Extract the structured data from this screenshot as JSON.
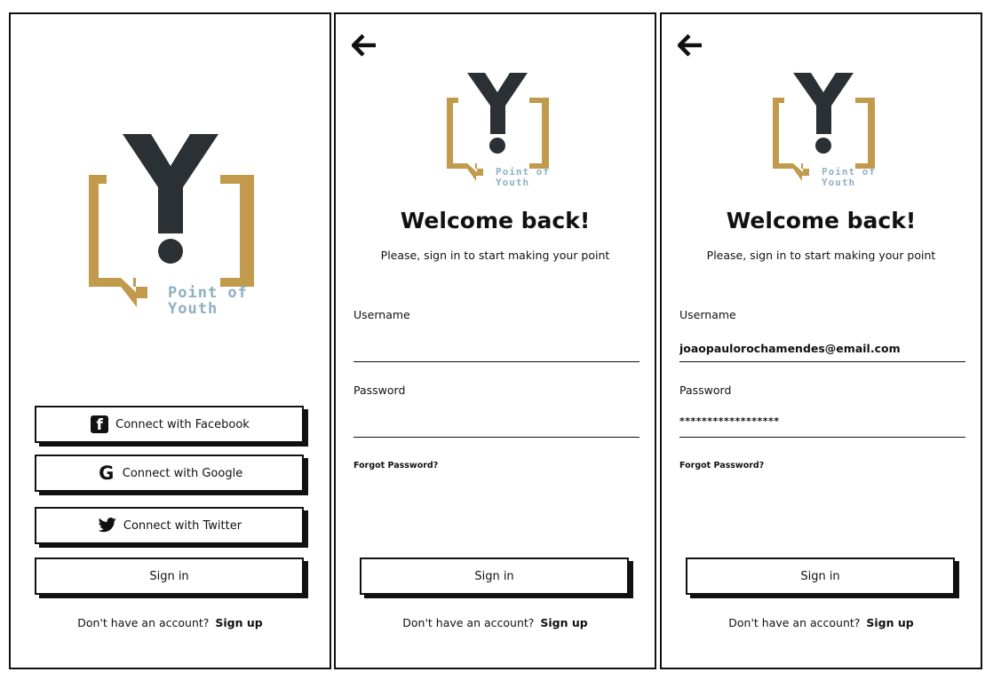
{
  "colors": {
    "gold": "#c29a4c",
    "dark": "#2a3033",
    "logo_text": "#8fb0c3",
    "border": "#111111"
  },
  "logo": {
    "line1": "Point of",
    "line2": "Youth"
  },
  "screen1": {
    "buttons": {
      "facebook": {
        "label": "Connect with Facebook",
        "icon": "facebook-icon"
      },
      "google": {
        "label": "Connect with Google",
        "icon": "google-icon"
      },
      "twitter": {
        "label": "Connect with Twitter",
        "icon": "twitter-icon"
      },
      "signin": "Sign in"
    },
    "footer": {
      "text": "Don't have an account?",
      "link": "Sign up"
    }
  },
  "screen2": {
    "title": "Welcome back!",
    "subtitle": "Please, sign in to start making your point",
    "username_label": "Username",
    "username_value": "",
    "password_label": "Password",
    "password_value": "",
    "forgot": "Forgot Password?",
    "signin": "Sign in",
    "footer": {
      "text": "Don't have an account?",
      "link": "Sign up"
    }
  },
  "screen3": {
    "title": "Welcome back!",
    "subtitle": "Please, sign in to start making your point",
    "username_label": "Username",
    "username_value": "joaopaulorochamendes@email.com",
    "password_label": "Password",
    "password_masked": "******************",
    "forgot": "Forgot Password?",
    "signin": "Sign in",
    "footer": {
      "text": "Don't have an account?",
      "link": "Sign up"
    }
  }
}
